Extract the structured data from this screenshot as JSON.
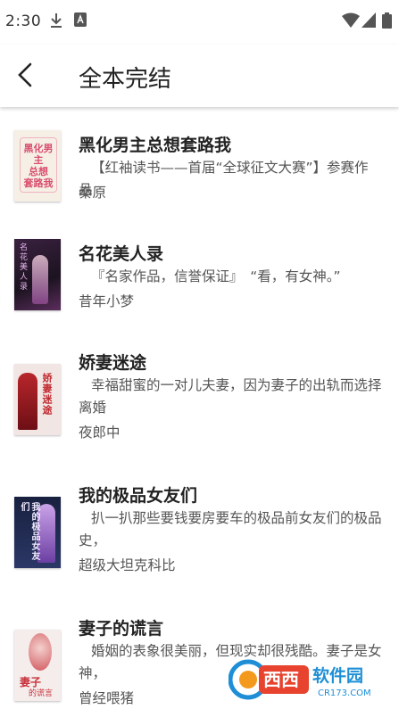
{
  "status_bar": {
    "time": "2:30"
  },
  "header": {
    "title": "全本完结",
    "back_icon": "chevron-left-icon"
  },
  "books": [
    {
      "title": "黑化男主总想套路我",
      "description": "【红袖读书——首届“全球征文大赛”】参赛作品",
      "author": "秦原",
      "cover": {
        "bg": "#f6efe6",
        "accent": "#d94f6e",
        "text": "黑化男主总想套路我"
      }
    },
    {
      "title": "名花美人录",
      "description": "『名家作品，信誉保证』　“看，有女神。”",
      "author": "昔年小梦",
      "cover": {
        "bg": "#2b1b2e",
        "accent": "#c28ac9",
        "text": "名花美人录"
      }
    },
    {
      "title": "娇妻迷途",
      "description": "幸福甜蜜的一对儿夫妻，因为妻子的出轨而选择离婚",
      "author": "夜郎中",
      "cover": {
        "bg": "#f2e6e4",
        "accent": "#c0272d",
        "text": "娇妻迷途"
      }
    },
    {
      "title": "我的极品女友们",
      "description": "扒一扒那些要钱要房要车的极品前女友们的极品史，",
      "author": "超级大坦克科比",
      "cover": {
        "bg": "#1d2748",
        "accent": "#9d7bd8",
        "text": "我的极品女友们"
      }
    },
    {
      "title": "妻子的谎言",
      "description": "婚姻的表象很美丽，但现实却很残酷。妻子是女神，",
      "author": "曾经喂猪",
      "cover": {
        "bg": "#f5ecec",
        "accent": "#c8323a",
        "text": "妻子的谎言"
      }
    }
  ],
  "watermark": {
    "brand": "西西",
    "name": "软件园",
    "site": "CR173.COM"
  }
}
